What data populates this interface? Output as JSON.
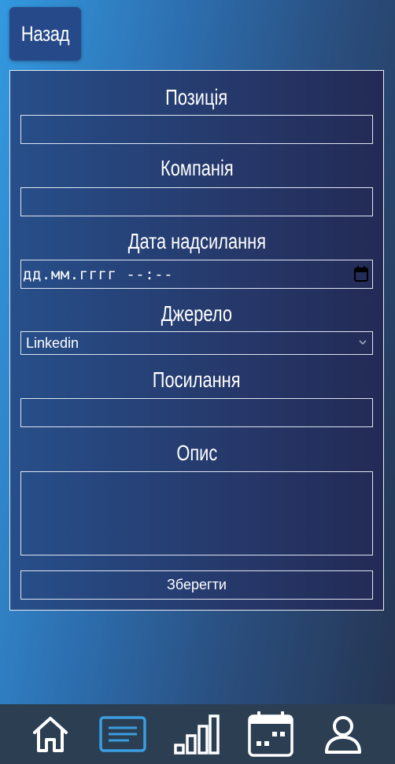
{
  "header": {
    "back_label": "Назад"
  },
  "form": {
    "position_label": "Позиція",
    "position_value": "",
    "company_label": "Компанія",
    "company_value": "",
    "date_label": "Дата надсилання",
    "date_placeholder": "дд.мм.гггг --:--",
    "source_label": "Джерело",
    "source_selected": "Linkedin",
    "link_label": "Посилання",
    "link_value": "",
    "description_label": "Опис",
    "description_value": "",
    "save_label": "Зберегти"
  },
  "bottom_nav": {
    "items": [
      {
        "icon": "home-icon",
        "active": false
      },
      {
        "icon": "list-icon",
        "active": true
      },
      {
        "icon": "bar-chart-icon",
        "active": false
      },
      {
        "icon": "calendar-icon",
        "active": false
      },
      {
        "icon": "user-icon",
        "active": false
      }
    ],
    "active_color": "#3a9ee0",
    "icon_color": "#ffffff"
  }
}
